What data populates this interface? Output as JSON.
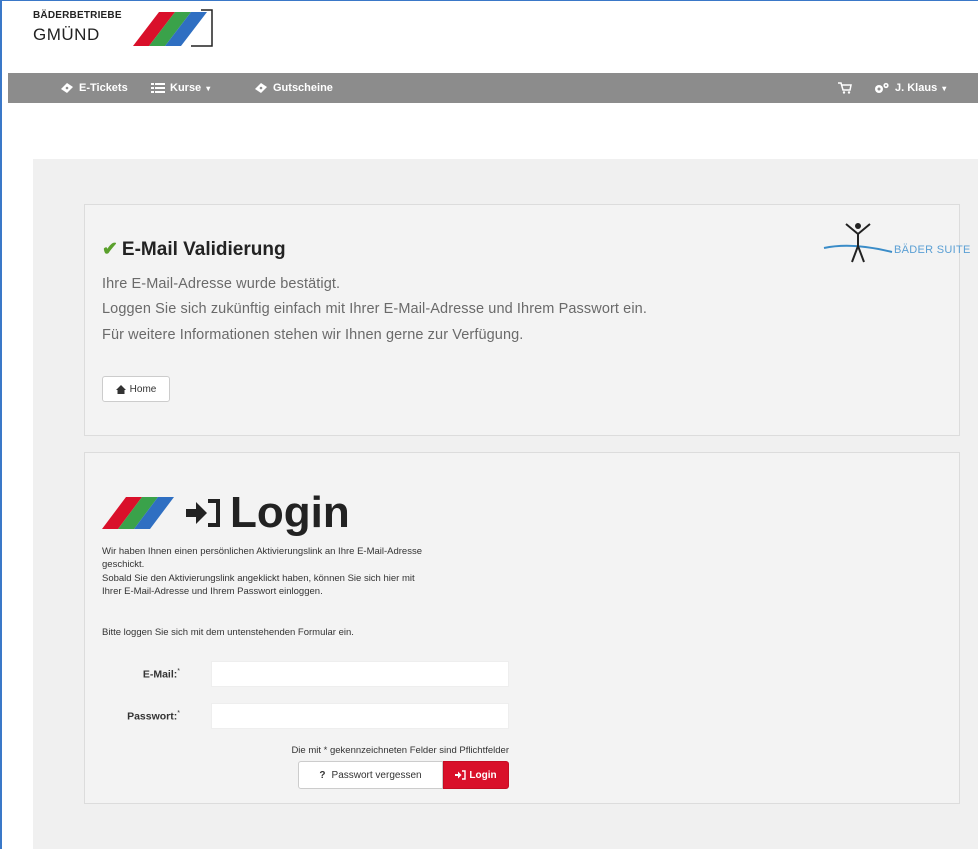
{
  "brand": {
    "line1": "BÄDERBETRIEBE",
    "line2": "GMÜND"
  },
  "nav": {
    "etickets": "E-Tickets",
    "kurse": "Kurse",
    "gutscheine": "Gutscheine",
    "user": "J. Klaus",
    "caret": "▾"
  },
  "validation": {
    "title": "E-Mail Validierung",
    "line1": "Ihre E-Mail-Adresse wurde bestätigt.",
    "line2": "Loggen Sie sich zukünftig einfach mit Ihrer E-Mail-Adresse und Ihrem Passwort ein.",
    "line3": "Für weitere Informationen stehen wir Ihnen gerne zur Verfügung.",
    "home_button": "Home"
  },
  "suite_logo_text": "BÄDER SUITE",
  "login": {
    "title": "Login",
    "info_line1": "Wir haben Ihnen einen persönlichen Aktivierungslink an Ihre E-Mail-Adresse",
    "info_line2": "geschickt.",
    "info_line3": "Sobald Sie den Aktivierungslink angeklickt haben, können Sie sich hier mit",
    "info_line4": "Ihrer E-Mail-Adresse und Ihrem Passwort einloggen.",
    "info_line5": "Bitte loggen Sie sich mit dem untenstehenden Formular ein.",
    "email_label": "E-Mail:",
    "email_value": "",
    "password_label": "Passwort:",
    "password_value": "",
    "required_marker": "*",
    "required_note": "Die mit * gekennzeichneten Felder sind Pflichtfelder",
    "forgot_button": "Passwort vergessen",
    "login_button": "Login"
  },
  "colors": {
    "navbar": "#8c8c8c",
    "accent_red": "#d9102a",
    "check_green": "#5aa02c"
  }
}
